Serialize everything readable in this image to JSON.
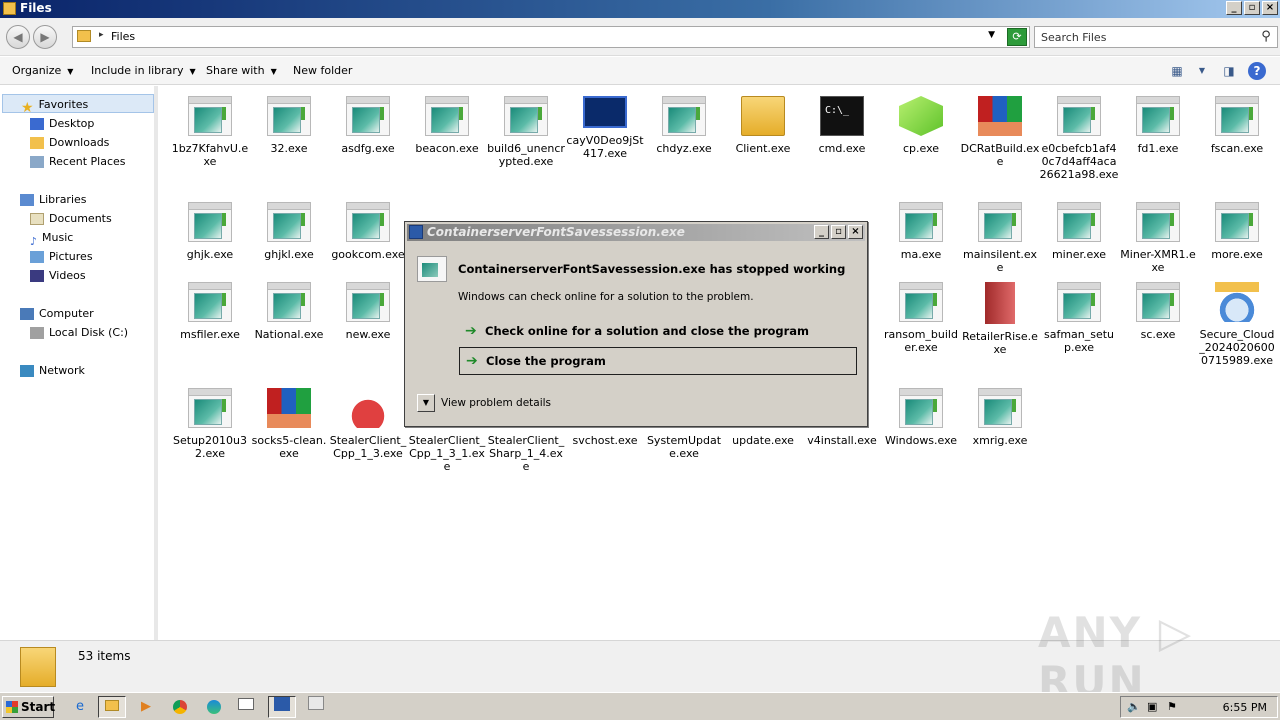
{
  "window": {
    "title": "Files"
  },
  "address": {
    "path": "Files",
    "search_placeholder": "Search Files"
  },
  "toolbar": {
    "organize": "Organize",
    "include": "Include in library",
    "share": "Share with",
    "new_folder": "New folder"
  },
  "sidebar": {
    "favorites": "Favorites",
    "desktop": "Desktop",
    "downloads": "Downloads",
    "recent": "Recent Places",
    "libraries": "Libraries",
    "documents": "Documents",
    "music": "Music",
    "pictures": "Pictures",
    "videos": "Videos",
    "computer": "Computer",
    "local_disk": "Local Disk (C:)",
    "network": "Network"
  },
  "files": [
    {
      "name": "1bz7KfahvU.exe",
      "icon": "exe"
    },
    {
      "name": "32.exe",
      "icon": "exe"
    },
    {
      "name": "asdfg.exe",
      "icon": "exe"
    },
    {
      "name": "beacon.exe",
      "icon": "exe"
    },
    {
      "name": "build6_unencrypted.exe",
      "icon": "exe"
    },
    {
      "name": "cayV0Deo9jSt417.exe",
      "icon": "network"
    },
    {
      "name": "chdyz.exe",
      "icon": "exe"
    },
    {
      "name": "Client.exe",
      "icon": "folder"
    },
    {
      "name": "cmd.exe",
      "icon": "cmd"
    },
    {
      "name": "cp.exe",
      "icon": "cube"
    },
    {
      "name": "DCRatBuild.exe",
      "icon": "winrar"
    },
    {
      "name": "e0cbefcb1af40c7d4aff4aca26621a98.exe",
      "icon": "exe"
    },
    {
      "name": "fd1.exe",
      "icon": "exe"
    },
    {
      "name": "fscan.exe",
      "icon": "exe"
    },
    {
      "name": "ghjk.exe",
      "icon": "exe"
    },
    {
      "name": "ghjkl.exe",
      "icon": "exe"
    },
    {
      "name": "gookcom.exe",
      "icon": "exe"
    },
    {
      "name": "ma.exe",
      "icon": "exe"
    },
    {
      "name": "mainsilent.exe",
      "icon": "exe"
    },
    {
      "name": "miner.exe",
      "icon": "exe"
    },
    {
      "name": "Miner-XMR1.exe",
      "icon": "exe"
    },
    {
      "name": "more.exe",
      "icon": "exe"
    },
    {
      "name": "msfiler.exe",
      "icon": "exe"
    },
    {
      "name": "National.exe",
      "icon": "exe"
    },
    {
      "name": "new.exe",
      "icon": "exe"
    },
    {
      "name": "ransom_builder.exe",
      "icon": "exe"
    },
    {
      "name": "RetailerRise.exe",
      "icon": "book"
    },
    {
      "name": "safman_setup.exe",
      "icon": "exe"
    },
    {
      "name": "sc.exe",
      "icon": "exe"
    },
    {
      "name": "Secure_Cloud_20240206000715989.exe",
      "icon": "installer"
    },
    {
      "name": "Setup2010u32.exe",
      "icon": "exe"
    },
    {
      "name": "socks5-clean.exe",
      "icon": "winrar"
    },
    {
      "name": "StealerClient_Cpp_1_3.exe",
      "icon": "mascot"
    },
    {
      "name": "StealerClient_Cpp_1_3_1.exe",
      "icon": "exe"
    },
    {
      "name": "StealerClient_Sharp_1_4.exe",
      "icon": "exe"
    },
    {
      "name": "svchost.exe",
      "icon": "exe"
    },
    {
      "name": "SystemUpdate.exe",
      "icon": "exe"
    },
    {
      "name": "update.exe",
      "icon": "exe"
    },
    {
      "name": "v4install.exe",
      "icon": "exe"
    },
    {
      "name": "Windows.exe",
      "icon": "exe"
    },
    {
      "name": "xmrig.exe",
      "icon": "exe"
    }
  ],
  "status": {
    "count": "53 items"
  },
  "dialog": {
    "title": "ContainerserverFontSavessession.exe",
    "heading": "ContainerserverFontSavessession.exe has stopped working",
    "sub": "Windows can check online for a solution to the problem.",
    "option1": "Check online for a solution and close the program",
    "option2": "Close the program",
    "details": "View problem details"
  },
  "taskbar": {
    "start": "Start",
    "time": "6:55 PM"
  },
  "watermark": "ANY RUN"
}
